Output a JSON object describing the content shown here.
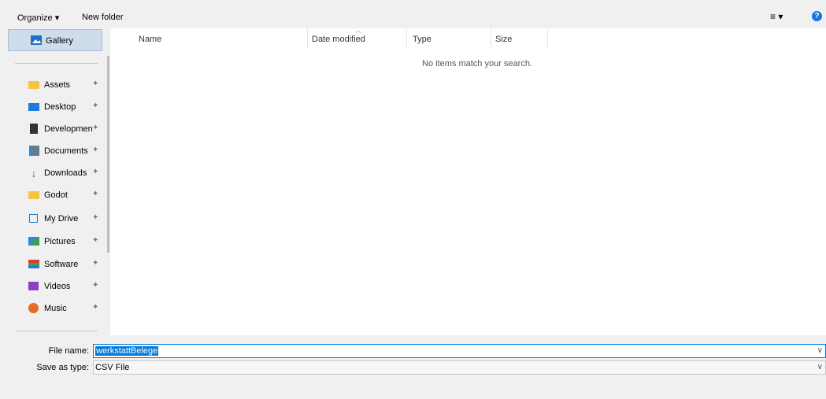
{
  "toolbar": {
    "organize_label": "Organize ▾",
    "new_folder_label": "New folder",
    "view_glyph": "≡ ▾",
    "help_glyph": "?"
  },
  "sidebar": {
    "gallery_label": "Gallery",
    "items": [
      {
        "label": "Assets",
        "icon": "folder-icon"
      },
      {
        "label": "Desktop",
        "icon": "desktop-icon"
      },
      {
        "label": "Development",
        "icon": "archive-icon"
      },
      {
        "label": "Documents",
        "icon": "documents-icon"
      },
      {
        "label": "Downloads",
        "icon": "download-arrow-icon"
      },
      {
        "label": "Godot",
        "icon": "folder-icon"
      },
      {
        "label": "My Drive",
        "icon": "drive-icon"
      },
      {
        "label": "Pictures",
        "icon": "pictures-icon"
      },
      {
        "label": "Software",
        "icon": "software-icon"
      },
      {
        "label": "Videos",
        "icon": "videos-icon"
      },
      {
        "label": "Music",
        "icon": "music-icon"
      }
    ],
    "pin_glyph": "📌"
  },
  "columns": {
    "name": "Name",
    "date_modified": "Date modified",
    "type": "Type",
    "size": "Size"
  },
  "main": {
    "empty_message": "No items match your search."
  },
  "form": {
    "file_name_label": "File name:",
    "file_name_value": "werkstattBelege",
    "save_as_type_label": "Save as type:",
    "save_as_type_value": "CSV File"
  },
  "colors": {
    "accent": "#0078d7",
    "chrome_bg": "#f0f0f0",
    "selected_nav_bg": "#cfdceb"
  }
}
